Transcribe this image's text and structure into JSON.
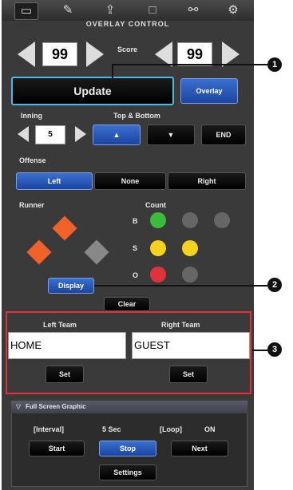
{
  "tabs": [
    {
      "icon": "monitor-icon",
      "glyph": "▭",
      "active": true
    },
    {
      "icon": "edit-list-icon",
      "glyph": "✎"
    },
    {
      "icon": "upload-list-icon",
      "glyph": "⇪"
    },
    {
      "icon": "window-icon",
      "glyph": "□"
    },
    {
      "icon": "network-icon",
      "glyph": "⚯"
    },
    {
      "icon": "gear-icon",
      "glyph": "⚙"
    }
  ],
  "header": {
    "title": "OVERLAY CONTROL"
  },
  "score": {
    "label": "Score",
    "left_value": "99",
    "right_value": "99"
  },
  "actions": {
    "update": "Update",
    "overlay": "Overlay"
  },
  "inning": {
    "label": "Inning",
    "value": "5",
    "top_bottom_label": "Top & Bottom",
    "up": "▲",
    "down": "▼",
    "end": "END"
  },
  "offense": {
    "label": "Offense",
    "options": [
      "Left",
      "None",
      "Right"
    ],
    "selected": "Left"
  },
  "runner": {
    "label": "Runner",
    "display": "Display",
    "clear": "Clear"
  },
  "count": {
    "label": "Count",
    "rows": [
      {
        "letter": "B"
      },
      {
        "letter": "S"
      },
      {
        "letter": "O"
      }
    ]
  },
  "teams": {
    "left_label": "Left Team",
    "right_label": "Right Team",
    "left_value": "HOME",
    "right_value": "GUEST",
    "set": "Set"
  },
  "full_screen": {
    "header": "Full Screen Graphic",
    "interval_label": "[Interval]",
    "interval_value": "5 Sec",
    "loop_label": "[Loop]",
    "loop_value": "ON",
    "start": "Start",
    "stop": "Stop",
    "next": "Next",
    "settings": "Settings"
  },
  "callouts": [
    "1",
    "2",
    "3"
  ],
  "colors": {
    "accent_blue": "#2a5bc0",
    "highlight_red": "#e0323c",
    "runner_orange": "#f0622a",
    "ball_green": "#3cbb3c",
    "strike_yellow": "#f5d21c"
  }
}
